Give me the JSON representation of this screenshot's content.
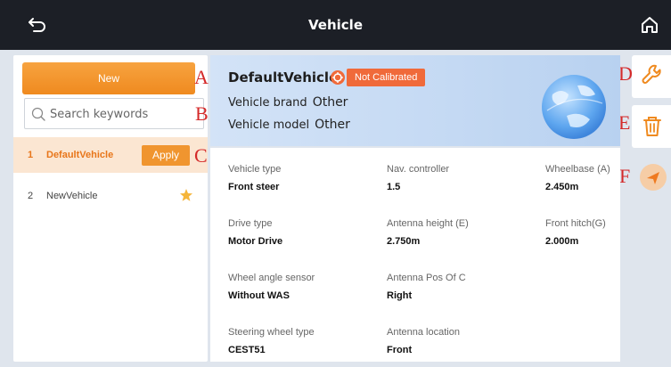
{
  "header": {
    "title": "Vehicle",
    "back_icon": "back-arrow-icon",
    "home_icon": "home-icon"
  },
  "sidebar": {
    "new_label": "New",
    "search_placeholder": "Search keywords",
    "vehicles": [
      {
        "num": "1",
        "name": "DefaultVehicle",
        "action": "Apply",
        "active": true
      },
      {
        "num": "2",
        "name": "NewVehicle",
        "favorite": true
      }
    ]
  },
  "annotations": [
    "A",
    "B",
    "C",
    "D",
    "E",
    "F"
  ],
  "vehicle": {
    "name": "DefaultVehicle",
    "status": "Not Calibrated",
    "brand_label": "Vehicle brand",
    "brand_value": "Other",
    "model_label": "Vehicle model",
    "model_value": "Other"
  },
  "details": [
    {
      "label": "Vehicle type",
      "value": "Front steer"
    },
    {
      "label": "Nav. controller",
      "value": "1.5"
    },
    {
      "label": "Wheelbase (A)",
      "value": "2.450m"
    },
    {
      "label": "Drive type",
      "value": "Motor Drive"
    },
    {
      "label": "Antenna height (E)",
      "value": "2.750m"
    },
    {
      "label": "Front hitch(G)",
      "value": "2.000m"
    },
    {
      "label": "Wheel angle sensor",
      "value": "Without WAS"
    },
    {
      "label": "Antenna Pos Of C",
      "value": "Right"
    },
    {
      "label": "Steering wheel type",
      "value": "CEST51"
    },
    {
      "label": "Antenna location",
      "value": "Front"
    }
  ],
  "actions": {
    "edit_icon": "wrench-icon",
    "delete_icon": "trash-icon",
    "send_icon": "send-icon"
  },
  "colors": {
    "accent": "#f0952f",
    "status": "#f06a3a",
    "topbar": "#1c1f26",
    "annotation": "#d42a2a"
  }
}
